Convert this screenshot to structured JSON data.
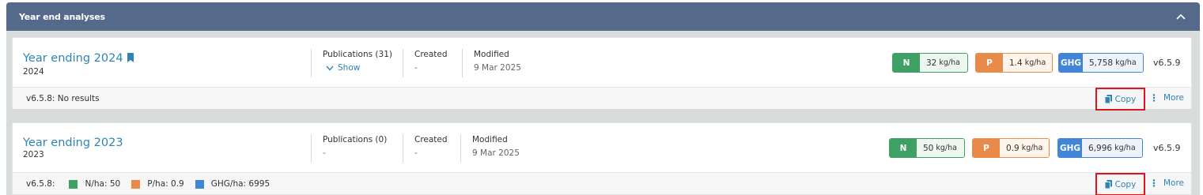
{
  "panel": {
    "title": "Year end analyses"
  },
  "analyses": [
    {
      "title": "Year ending 2024",
      "year": "2024",
      "publications_label": "Publications (31)",
      "show_label": "Show",
      "created_label": "Created",
      "created_value": "-",
      "modified_label": "Modified",
      "modified_value": "9 Mar 2025",
      "n_key": "N",
      "n_value": "32",
      "n_unit": "kg/ha",
      "p_key": "P",
      "p_value": "1.4",
      "p_unit": "kg/ha",
      "ghg_key": "GHG",
      "ghg_value": "5,758",
      "ghg_unit": "kg/ha",
      "version": "v6.5.9",
      "footer_text": "v6.5.8: No results",
      "copy_label": "Copy",
      "more_label": "More"
    },
    {
      "title": "Year ending 2023",
      "year": "2023",
      "publications_label": "Publications (0)",
      "publications_value": "-",
      "created_label": "Created",
      "created_value": "-",
      "modified_label": "Modified",
      "modified_value": "9 Mar 2025",
      "n_key": "N",
      "n_value": "50",
      "n_unit": "kg/ha",
      "p_key": "P",
      "p_value": "0.9",
      "p_unit": "kg/ha",
      "ghg_key": "GHG",
      "ghg_value": "6,996",
      "ghg_unit": "kg/ha",
      "version": "v6.5.9",
      "footer_prefix": "v6.5.8:",
      "legend": [
        {
          "label": "N/ha: 50",
          "color": "#3fa066"
        },
        {
          "label": "P/ha: 0.9",
          "color": "#e88a4a"
        },
        {
          "label": "GHG/ha: 6995",
          "color": "#4185d6"
        }
      ],
      "copy_label": "Copy",
      "more_label": "More"
    }
  ]
}
